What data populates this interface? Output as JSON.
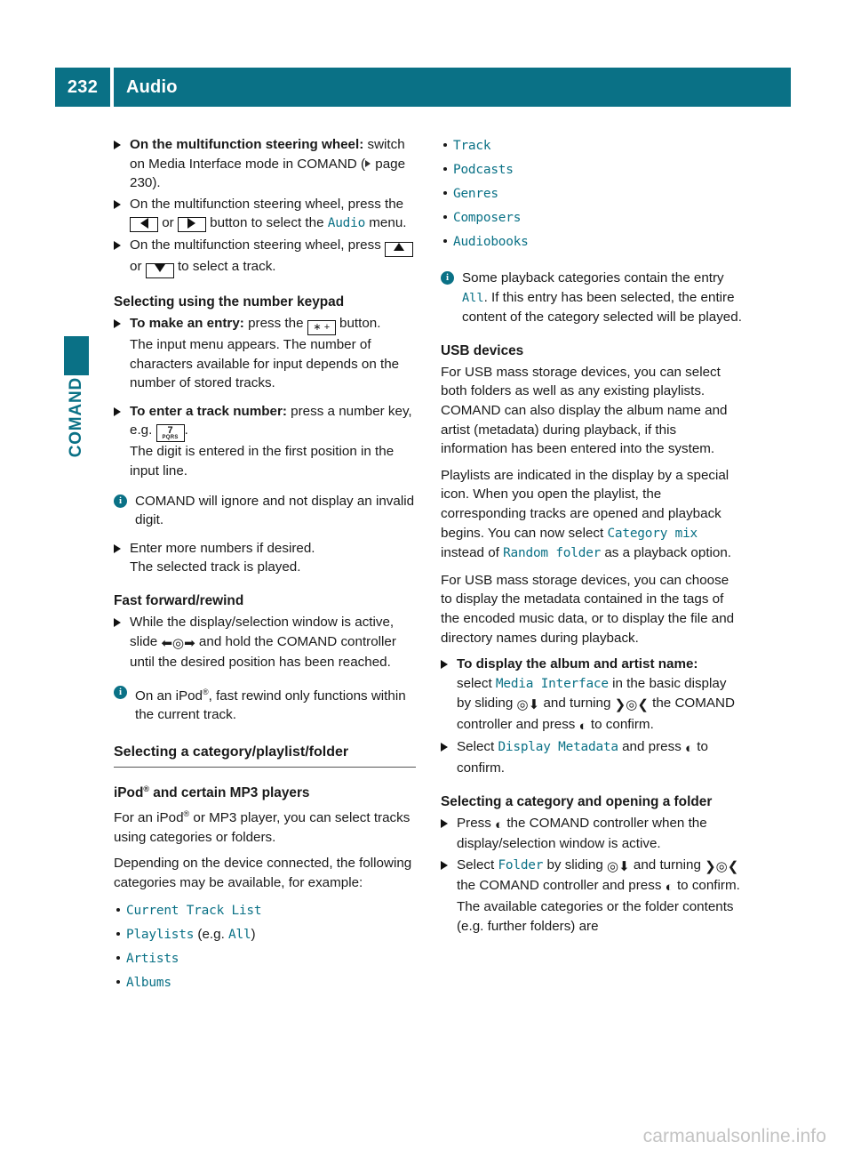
{
  "header": {
    "page_number": "232",
    "title": "Audio"
  },
  "sidebar": {
    "tab_label": "COMAND"
  },
  "colors": {
    "accent_teal": "#0a7186",
    "text": "#1a1a1a",
    "watermark": "#c3c3c3"
  },
  "left_column": {
    "step_mfsw_switch": {
      "lead": "On the multifunction steering wheel:",
      "rest": " switch on Media Interface mode in COMAND (",
      "ref": " page 230).",
      "ref_icon": "reference-triangle-icon"
    },
    "step_mfsw_select_menu": {
      "part1": "On the multifunction steering wheel, press the ",
      "key_left": "left-arrow-button",
      "between": " or ",
      "key_right": "right-arrow-button",
      "part2": " button to select the ",
      "menu": "Audio",
      "part3": " menu."
    },
    "step_mfsw_select_track": {
      "part1": "On the multifunction steering wheel, press ",
      "key_up": "up-arrow-button",
      "between": " or ",
      "key_down": "down-arrow-button",
      "part2": " to select a track."
    },
    "heading_number_keypad": "Selecting using the number keypad",
    "step_make_entry": {
      "lead": "To make an entry:",
      "part1": " press the ",
      "key": "star-plus-button",
      "key_label": "∗ +",
      "part2": " button.",
      "follow": "The input menu appears. The number of characters available for input depends on the number of stored tracks."
    },
    "step_track_number": {
      "lead": "To enter a track number:",
      "part1": " press a number key, e.g. ",
      "key_digit": "7",
      "key_letters": "PQRS",
      "part2": ".",
      "follow": "The digit is entered in the first position in the input line."
    },
    "note_invalid_digit": "COMAND will ignore and not display an invalid digit.",
    "step_enter_more": {
      "part1": "Enter more numbers if desired.",
      "follow": "The selected track is played."
    },
    "heading_fast_forward": "Fast forward/rewind",
    "step_fast_forward": {
      "part1": "While the display/selection window is active, slide ",
      "glyph": "slide-left-right-controller-icon",
      "part2": " and hold the COMAND controller until the desired position has been reached."
    },
    "note_ipod_rewind": {
      "part1": "On an iPod",
      "reg": "®",
      "part2": ", fast rewind only functions within the current track."
    },
    "heading_select_category": "Selecting a category/playlist/folder",
    "heading_ipod_mp3": {
      "part1": "iPod",
      "reg": "®",
      "part2": " and certain MP3 players"
    },
    "para_ipod": {
      "part1": "For an iPod",
      "reg": "®",
      "part2": " or MP3 player, you can select tracks using categories or folders."
    },
    "para_depending": "Depending on the device connected, the following categories may be available, for example:",
    "category_list": [
      {
        "name": "Current Track List",
        "suffix": ""
      },
      {
        "name": "Playlists",
        "suffix": " (e.g. ",
        "extra": "All",
        "suffix2": ")"
      },
      {
        "name": "Artists",
        "suffix": ""
      },
      {
        "name": "Albums",
        "suffix": ""
      }
    ]
  },
  "right_column": {
    "category_list_cont": [
      {
        "name": "Track"
      },
      {
        "name": "Podcasts"
      },
      {
        "name": "Genres"
      },
      {
        "name": "Composers"
      },
      {
        "name": "Audiobooks"
      }
    ],
    "note_all_entry": {
      "part1": "Some playback categories contain the entry ",
      "mono": "All",
      "part2": ". If this entry has been selected, the entire content of the category selected will be played."
    },
    "heading_usb": "USB devices",
    "para_usb_1": "For USB mass storage devices, you can select both folders as well as any existing playlists. COMAND can also display the album name and artist (metadata) during playback, if this information has been entered into the system.",
    "para_usb_2": {
      "part1": "Playlists are indicated in the display by a special icon. When you open the playlist, the corresponding tracks are opened and playback begins. You can now select ",
      "mono1": "Category mix",
      "mid": " instead of ",
      "mono2": "Random folder",
      "part2": " as a playback option."
    },
    "para_usb_3": "For USB mass storage devices, you can choose to display the metadata contained in the tags of the encoded music data, or to display the file and directory names during playback.",
    "step_display_album": {
      "lead": "To display the album and artist name:",
      "part1": " select ",
      "mono": "Media Interface",
      "part2": " in the basic display by sliding ",
      "glyph_slide": "slide-down-controller-icon",
      "part3": " and turning ",
      "glyph_turn": "turn-controller-icon",
      "part4": " the COMAND controller and press ",
      "glyph_press": "press-controller-icon",
      "part5": " to confirm."
    },
    "step_display_metadata": {
      "part1": "Select ",
      "mono": "Display Metadata",
      "part2": " and press ",
      "glyph_press": "press-controller-icon",
      "part3": " to confirm."
    },
    "heading_open_folder": "Selecting a category and opening a folder",
    "step_press_controller": {
      "part1": "Press ",
      "glyph_press": "press-controller-icon",
      "part2": " the COMAND controller when the display/selection window is active."
    },
    "step_select_folder": {
      "part1": "Select ",
      "mono": "Folder",
      "part2": " by sliding ",
      "glyph_slide": "slide-down-controller-icon",
      "part3": " and turning ",
      "glyph_turn": "turn-controller-icon",
      "part4": " the COMAND controller and press ",
      "glyph_press": "press-controller-icon",
      "part5": " to confirm.",
      "follow": "The available categories or the folder contents (e.g. further folders) are"
    }
  },
  "footer": {
    "watermark": "carmanualsonline.info"
  }
}
